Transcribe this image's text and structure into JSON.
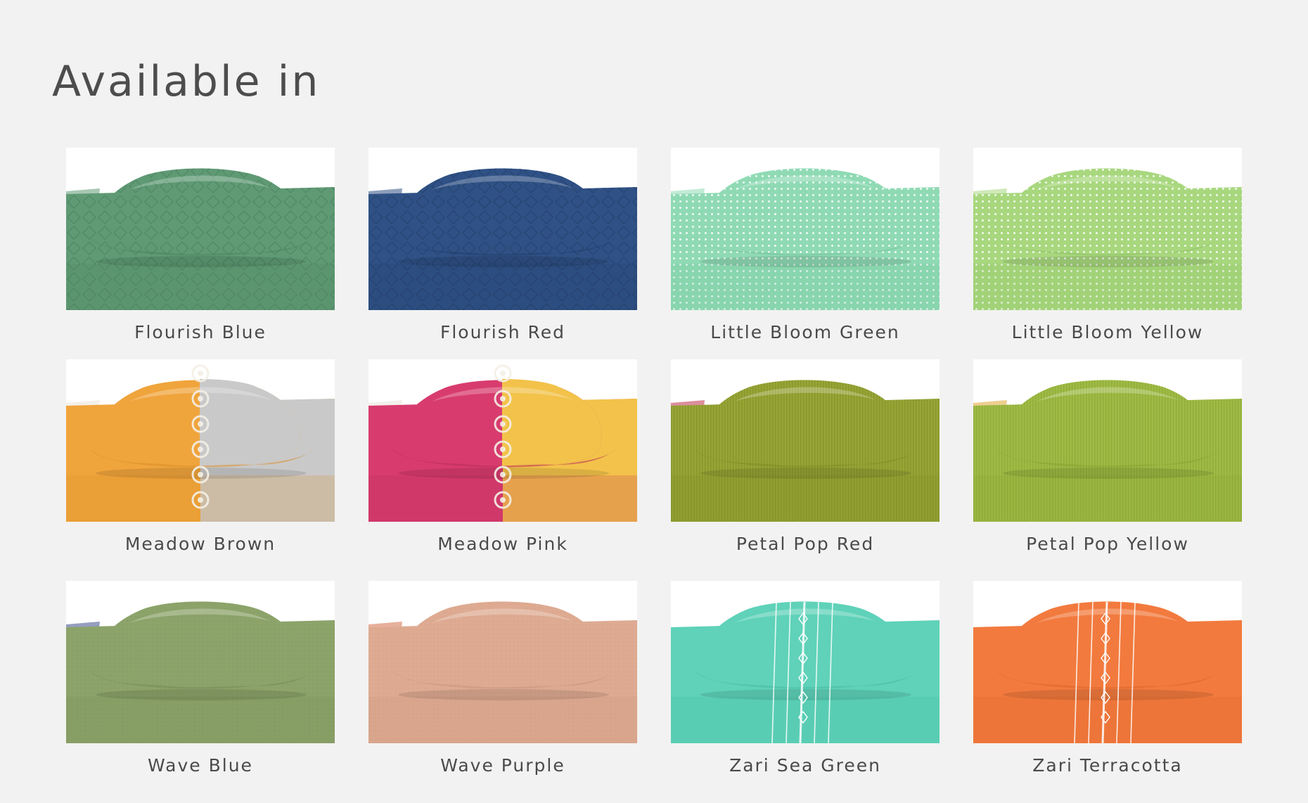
{
  "page": {
    "title": "Available in",
    "background": "#f2f2f2"
  },
  "swatches": [
    {
      "name": "Flourish Blue",
      "colors": {
        "main": "#5f9a74",
        "dark": "#4c8361",
        "light": "#7fb491",
        "accent": "#5f9a74"
      },
      "pattern": "lattice",
      "icon": "pillow-bedsheet-image"
    },
    {
      "name": "Flourish Red",
      "colors": {
        "main": "#2f5185",
        "dark": "#23406d",
        "light": "#4a6c9f",
        "accent": "#2f5185"
      },
      "pattern": "lattice",
      "icon": "pillow-bedsheet-image"
    },
    {
      "name": "Little Bloom Green",
      "colors": {
        "main": "#8fdab4",
        "dark": "#72c59c",
        "light": "#b5ead0",
        "accent": "#8fdab4"
      },
      "pattern": "dots",
      "icon": "pillow-bedsheet-image"
    },
    {
      "name": "Little Bloom Yellow",
      "colors": {
        "main": "#a8d77e",
        "dark": "#8cc262",
        "light": "#c6e7a6",
        "accent": "#a8d77e"
      },
      "pattern": "dots",
      "icon": "pillow-bedsheet-image"
    },
    {
      "name": "Meadow Brown",
      "colors": {
        "main": "#f0a43c",
        "dark": "#d88e2a",
        "light": "#c9c9c9",
        "accent": "#bdbdbd"
      },
      "pattern": "split",
      "icon": "pillow-bedsheet-image"
    },
    {
      "name": "Meadow Pink",
      "colors": {
        "main": "#d83c6f",
        "dark": "#bb2c5a",
        "light": "#f2c24a",
        "accent": "#eab83a"
      },
      "pattern": "split",
      "icon": "pillow-bedsheet-image"
    },
    {
      "name": "Petal Pop Red",
      "colors": {
        "main": "#97a536",
        "dark": "#7f8c26",
        "light": "#adb94e",
        "accent": "#c0334a"
      },
      "pattern": "stripes",
      "icon": "pillow-bedsheet-image"
    },
    {
      "name": "Petal Pop Yellow",
      "colors": {
        "main": "#9fbb45",
        "dark": "#87a333",
        "light": "#b7cf62",
        "accent": "#e0a634"
      },
      "pattern": "stripes",
      "icon": "pillow-bedsheet-image"
    },
    {
      "name": "Wave Blue",
      "colors": {
        "main": "#8ca36a",
        "dark": "#768d55",
        "light": "#a3b884",
        "accent": "#3c4f8a"
      },
      "pattern": "plain",
      "icon": "pillow-bedsheet-image"
    },
    {
      "name": "Wave Purple",
      "colors": {
        "main": "#deab92",
        "dark": "#c8937a",
        "light": "#ecc2ad",
        "accent": "#d4704a"
      },
      "pattern": "plain",
      "icon": "pillow-bedsheet-image"
    },
    {
      "name": "Zari Sea Green",
      "colors": {
        "main": "#5fd2b9",
        "dark": "#45bca2",
        "light": "#8be2cf",
        "accent": "#ffffff"
      },
      "pattern": "zari",
      "icon": "pillow-bedsheet-image"
    },
    {
      "name": "Zari Terracotta",
      "colors": {
        "main": "#f27a3e",
        "dark": "#da652b",
        "light": "#f79a6a",
        "accent": "#ffffff"
      },
      "pattern": "zari",
      "icon": "pillow-bedsheet-image"
    }
  ]
}
